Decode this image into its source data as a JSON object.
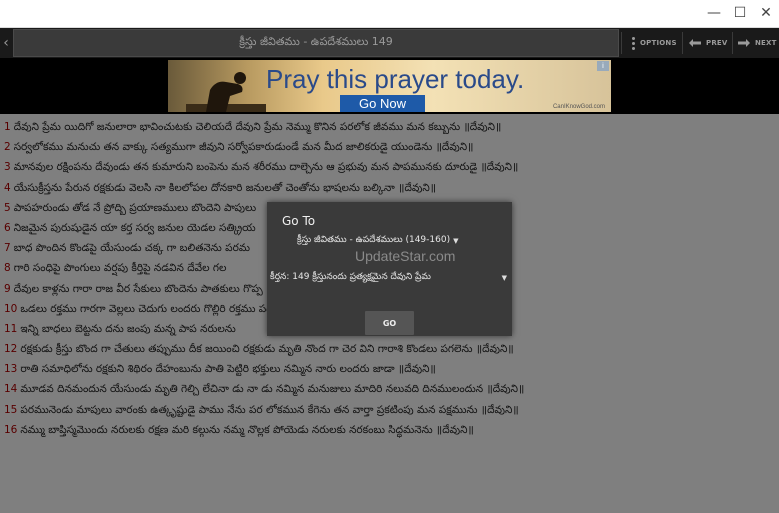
{
  "window": {
    "minimize_glyph": "—",
    "maximize_glyph": "☐",
    "close_glyph": "✕"
  },
  "toolbar": {
    "back_glyph": "‹",
    "title": "క్రీస్తు జీవితము - ఉపదేశములు 149",
    "options_label": "OPTIONS",
    "prev_label": "PREV",
    "next_label": "NEXT"
  },
  "ad": {
    "headline": "Pray this prayer today.",
    "cta": "Go Now",
    "site": "CanIKnowGod.com",
    "info": "i"
  },
  "verses": [
    {
      "num": "1",
      "text": "దేవుని ప్రేమ యిదిగో జనులారా భావించుటకు చెలియదే దేవుని ప్రేమ నెమ్ము కొనిన పరలోక జీవము మన కబ్బును ॥దేవుని॥"
    },
    {
      "num": "2",
      "text": "సర్వలోకము మనుచు తన వాక్కు సత్యముగా జీవుని సర్వోపకారుడుండే మన మీద జాలికరుడై యుండెను ॥దేవుని॥"
    },
    {
      "num": "3",
      "text": "మానవుల రక్షింపను దేవుండు తన కుమారుని బంపెను మన శరీరము దాల్చెను ఆ ప్రభువు మన పాపమునకు దూరుడై ॥దేవుని॥"
    },
    {
      "num": "4",
      "text": "యేసుక్రీస్తను పేరున రక్షకుడు వెలసి నా కిలలోపల దోనకారి జనులతో చెంతోను భాషలను బల్కినా ॥దేవుని॥"
    },
    {
      "num": "5",
      "text": "పాపహరుండు తోడ నే ప్రోద్బి ప్రయాణములు బొందెని పాపులు"
    },
    {
      "num": "6",
      "text": "నిజమైన పురుషుడైన యా కర్త సర్వ జనుల యెడల సత్క్రియ"
    },
    {
      "num": "7",
      "text": "బాధ పొందిన కొండపై యేసుండు చక్క గా బలితనెను పరమ"
    },
    {
      "num": "8",
      "text": "గారి సంధిపై పొంగులు వర్షపు కీర్తిపై నడవిన దేవేల గల"
    },
    {
      "num": "9",
      "text": "దేవుల కాళ్లను గారా రాజ వీర సేకులు బొందెను పాతకులు గొప్ప"
    },
    {
      "num": "10",
      "text": "ఒడలు రక్తము గారగా వెల్లలు చెదుగు లందరు గొల్లిరి రక్తము పడ"
    },
    {
      "num": "11",
      "text": "ఇన్ని బాధలు బెట్టను దను జంపు మన్న పాప నరులను"
    },
    {
      "num": "12",
      "text": "రక్షకుడు క్రీస్తు బొంద గా చేతులు తప్పుము దీక జయించి రక్షకుడు మృతి నొంద గా చెర విని గారాశి కొండలు పగలెను ॥దేవుని॥"
    },
    {
      "num": "13",
      "text": "రాతి సమాధిలోను రక్షకుని శిథిరం దేహంబును పాతి పెట్టిరి భక్తులు నమ్మిన నారు లందరు జాడా ॥దేవుని॥"
    },
    {
      "num": "14",
      "text": "మూడవ దినమందున యేసుండు మృతి గెల్చి లేచినా డు నా డు నమ్మిన మనుజులు మాదిరి నలువది దినములందున ॥దేవుని॥"
    },
    {
      "num": "15",
      "text": "పరమునెండు మాపులు వారంకు ఉత్కృష్టుడై పాము నేను పర లోకమున కేగెను తన వార్తా ప్రకటింపు మన పక్షమును ॥దేవుని॥"
    },
    {
      "num": "16",
      "text": "నమ్ము బాప్తిస్మమొందు నరులకు రక్షణ మరి కల్గును నమ్మ నొల్లక పోయెడు నరులకు నరకంబు సిద్ధమనెను ॥దేవుని॥"
    }
  ],
  "dialog": {
    "title": "Go To",
    "book_select": "క్రీస్తు జీవితము - ఉపదేశములు (149-160)",
    "watermark": "UpdateStar.com",
    "song_select": "కీర్తన: 149  క్రీస్తునందు ప్రత్యక్షమైన దేవుని ప్రేమ",
    "go_label": "GO"
  },
  "colors": {
    "toolbar_bg": "#1a1a1a",
    "verse_number": "#b00000",
    "dialog_bg": "#3a3a3a",
    "ad_button": "#1e5aa8"
  }
}
